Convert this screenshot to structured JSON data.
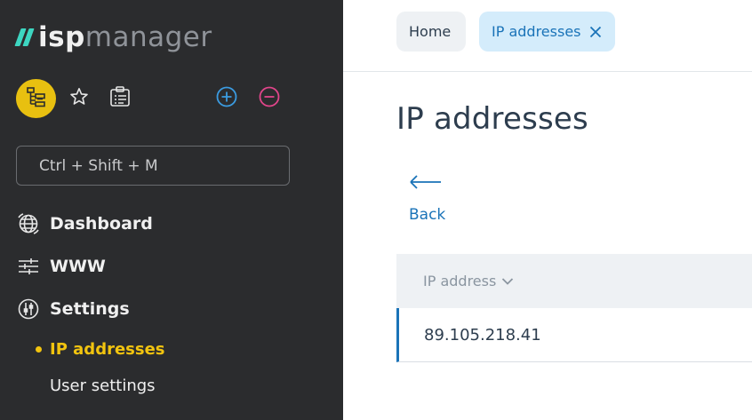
{
  "sidebar": {
    "logo": {
      "part1": "isp",
      "part2": "manager"
    },
    "toolbar": {
      "tree_icon": "tree-structure-icon",
      "favorite_icon": "star-icon",
      "clipboard_icon": "clipboard-list-icon",
      "add_icon": "plus-circle-icon",
      "remove_icon": "minus-circle-icon"
    },
    "search": {
      "placeholder": "Ctrl + Shift + M"
    },
    "nav": [
      {
        "label": "Dashboard",
        "icon": "globe-icon"
      },
      {
        "label": "WWW",
        "icon": "sliders-icon"
      },
      {
        "label": "Settings",
        "icon": "settings-dial-icon"
      }
    ],
    "settings_sub": [
      {
        "label": "IP addresses",
        "active": true
      },
      {
        "label": "User settings",
        "active": false
      }
    ],
    "colors": {
      "background": "#2b2c2e",
      "accent": "#f2c40f",
      "logo_mark": "#3dd6c1"
    }
  },
  "tabs": [
    {
      "label": "Home"
    },
    {
      "label": "IP addresses",
      "closable": true
    }
  ],
  "page": {
    "title": "IP addresses",
    "back_label": "Back"
  },
  "table": {
    "columns": [
      {
        "label": "IP address",
        "sort": "descending"
      }
    ],
    "rows": [
      [
        "89.105.218.41"
      ]
    ]
  },
  "colors": {
    "link": "#1a73b8",
    "title": "#2d3d4e"
  }
}
